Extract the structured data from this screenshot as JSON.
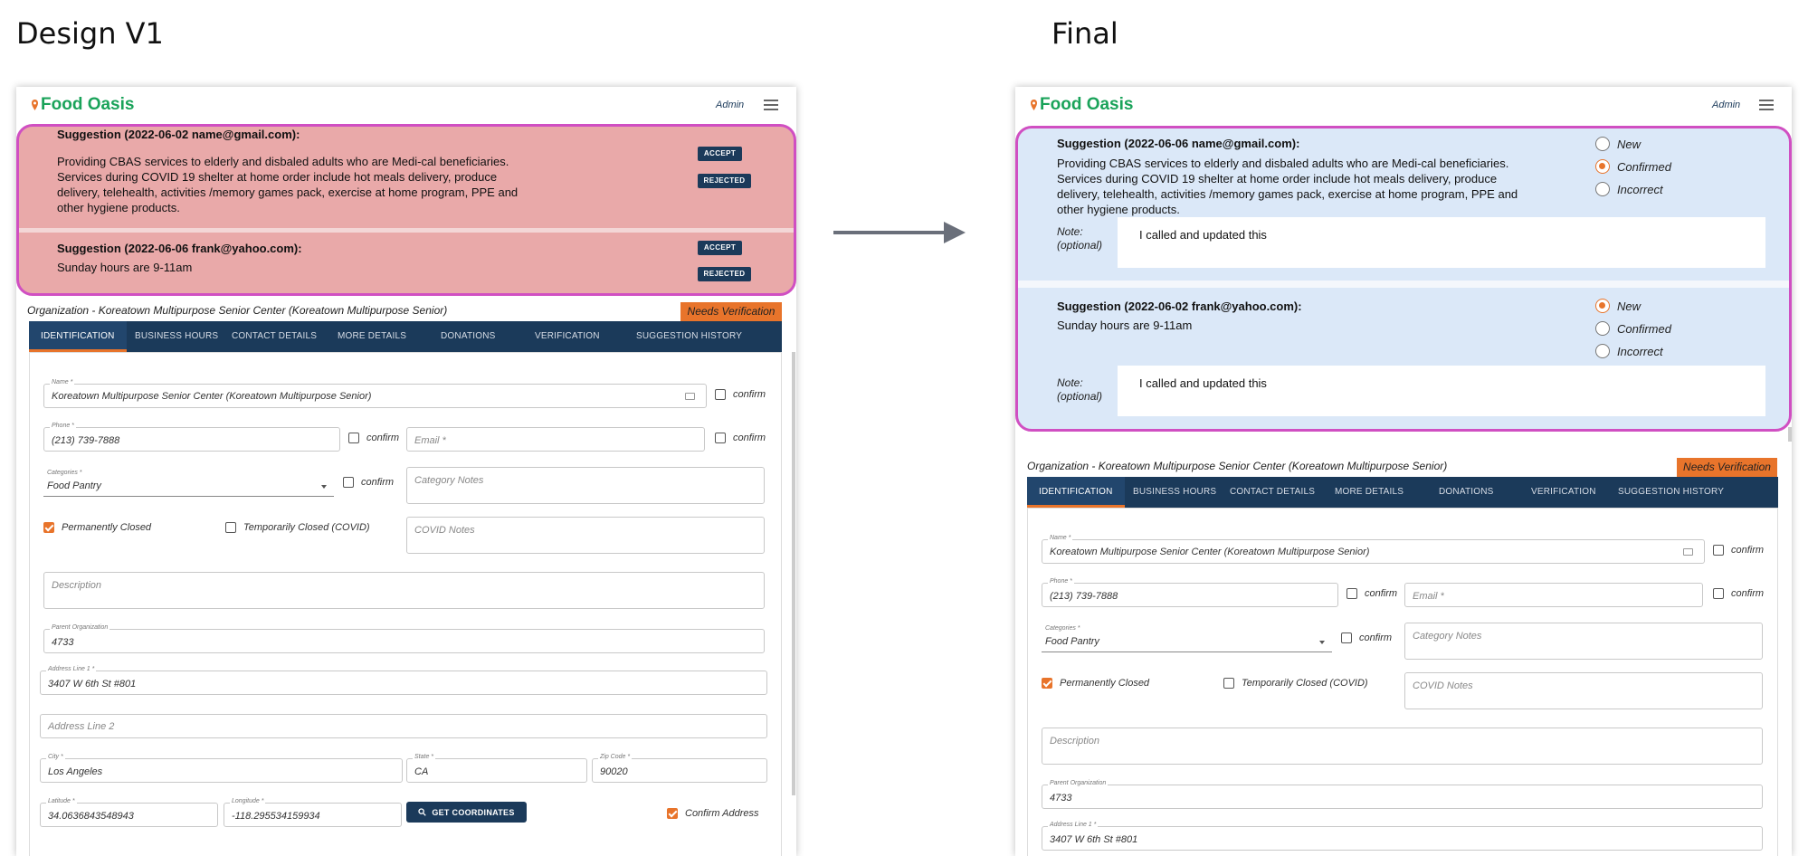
{
  "headings": {
    "left": "Design V1",
    "right": "Final"
  },
  "app": {
    "name": "Food Oasis",
    "admin_label": "Admin"
  },
  "v1": {
    "suggestions": [
      {
        "title": "Suggestion (2022-06-02 name@gmail.com):",
        "lines": [
          "Providing CBAS services to elderly and disbaled adults who are Medi-cal beneficiaries.",
          "Services during COVID 19 shelter at home order include hot meals delivery, produce",
          "delivery, telehealth, activities /memory games pack, exercise at home program, PPE and",
          "other hygiene products."
        ],
        "accept": "ACCEPT",
        "reject": "REJECTED"
      },
      {
        "title": "Suggestion (2022-06-06 frank@yahoo.com):",
        "lines": [
          "Sunday hours are 9-11am"
        ],
        "accept": "ACCEPT",
        "reject": "REJECTED"
      }
    ]
  },
  "final": {
    "suggestions": [
      {
        "title": "Suggestion (2022-06-06 name@gmail.com):",
        "lines": [
          "Providing CBAS services to elderly and disbaled adults who are Medi-cal beneficiaries.",
          "Services during COVID 19 shelter at home order include hot meals delivery, produce",
          "delivery, telehealth, activities /memory games pack, exercise at home program, PPE and",
          "other hygiene products."
        ],
        "options": [
          "New",
          "Confirmed",
          "Incorrect"
        ],
        "selected": "Confirmed",
        "note_label": [
          "Note:",
          "(optional)"
        ],
        "note": "I called and updated this"
      },
      {
        "title": "Suggestion (2022-06-02 frank@yahoo.com):",
        "lines": [
          "Sunday hours are 9-11am"
        ],
        "options": [
          "New",
          "Confirmed",
          "Incorrect"
        ],
        "selected": "New",
        "note_label": [
          "Note:",
          "(optional)"
        ],
        "note": "I called and updated this"
      }
    ]
  },
  "org": {
    "title": "Organization - Koreatown Multipurpose Senior Center (Koreatown Multipurpose Senior)",
    "status_badge": "Needs Verification"
  },
  "tabs": [
    "IDENTIFICATION",
    "BUSINESS HOURS",
    "CONTACT DETAILS",
    "MORE DETAILS",
    "DONATIONS",
    "VERIFICATION",
    "SUGGESTION HISTORY"
  ],
  "form": {
    "name_label": "Name *",
    "name_value": "Koreatown Multipurpose Senior Center (Koreatown Multipurpose Senior)",
    "confirm": "confirm",
    "phone_label": "Phone *",
    "phone_value": "(213) 739-7888",
    "email_placeholder": "Email *",
    "categories_label": "Categories *",
    "categories_value": "Food Pantry",
    "category_notes_placeholder": "Category Notes",
    "permanently_closed": "Permanently Closed",
    "temporarily_closed": "Temporarily Closed (COVID)",
    "covid_notes_placeholder": "COVID Notes",
    "description_placeholder": "Description",
    "parent_org_label": "Parent Organization",
    "parent_org_value": "4733",
    "address1_label": "Address Line 1 *",
    "address1_value": "3407 W 6th St #801",
    "address2_placeholder": "Address Line 2",
    "city_label": "City *",
    "city_value": "Los Angeles",
    "state_label": "State *",
    "state_value": "CA",
    "zip_label": "Zip Code *",
    "zip_value": "90020",
    "lat_label": "Latitude *",
    "lat_value": "34.0636843548943",
    "lon_label": "Longitude *",
    "lon_value": "-118.295534159934",
    "get_coords": "GET COORDINATES",
    "confirm_address": "Confirm Address"
  },
  "colors": {
    "accent": "#e8742b",
    "navy": "#1b3a5a",
    "brand_green": "#1aa35a",
    "highlight": "#d04fc2",
    "v1_bg": "#e9a9a9",
    "final_bg": "#dbe8f8"
  }
}
